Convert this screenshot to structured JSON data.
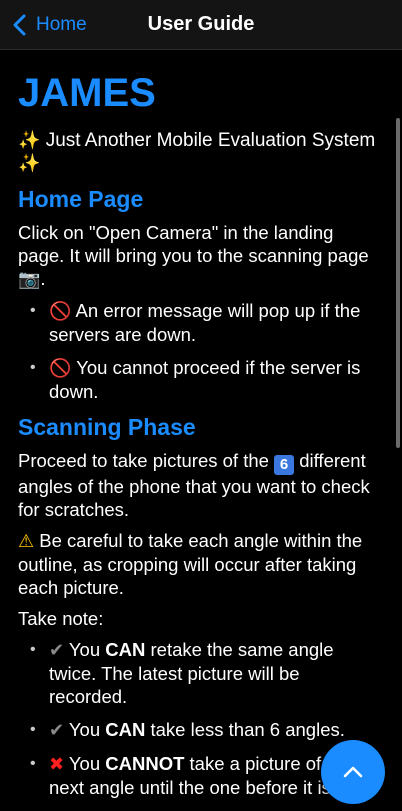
{
  "header": {
    "back_label": "Home",
    "title": "User Guide"
  },
  "colors": {
    "accent": "#1b8cff",
    "background": "#000000",
    "header_bg": "#141414"
  },
  "content": {
    "app_title": "JAMES",
    "subtitle": "Just Another Mobile Evaluation System",
    "home_section": {
      "heading": "Home Page",
      "intro": "Click on \"Open Camera\" in the landing page. It will bring you to the scanning page",
      "bullets": [
        "An error message will pop up if the servers are down.",
        "You cannot proceed if the server is down."
      ]
    },
    "scan_section": {
      "heading": "Scanning Phase",
      "intro_before": "Proceed to take pictures of the",
      "badge": "6",
      "intro_after": "different angles of the phone that you want to check for scratches.",
      "warning": "Be careful to take each angle within the outline, as cropping will occur after taking each picture.",
      "take_note": "Take note:",
      "notes": [
        {
          "pre": "You",
          "bold": "CAN",
          "post": "retake the same angle twice. The latest picture will be recorded."
        },
        {
          "pre": "You",
          "bold": "CAN",
          "post": "take less than 6 angles."
        },
        {
          "pre": "You",
          "bold": "CANNOT",
          "post": "take a picture of the next angle until the one before it is"
        }
      ]
    }
  },
  "icons": {
    "back": "chevron-left-icon",
    "sparkles": "sparkles-icon",
    "camera": "camera-icon",
    "prohibited": "prohibited-icon",
    "warning": "warning-icon",
    "check": "check-icon",
    "cross": "cross-icon",
    "scroll_top": "chevron-up-icon"
  }
}
